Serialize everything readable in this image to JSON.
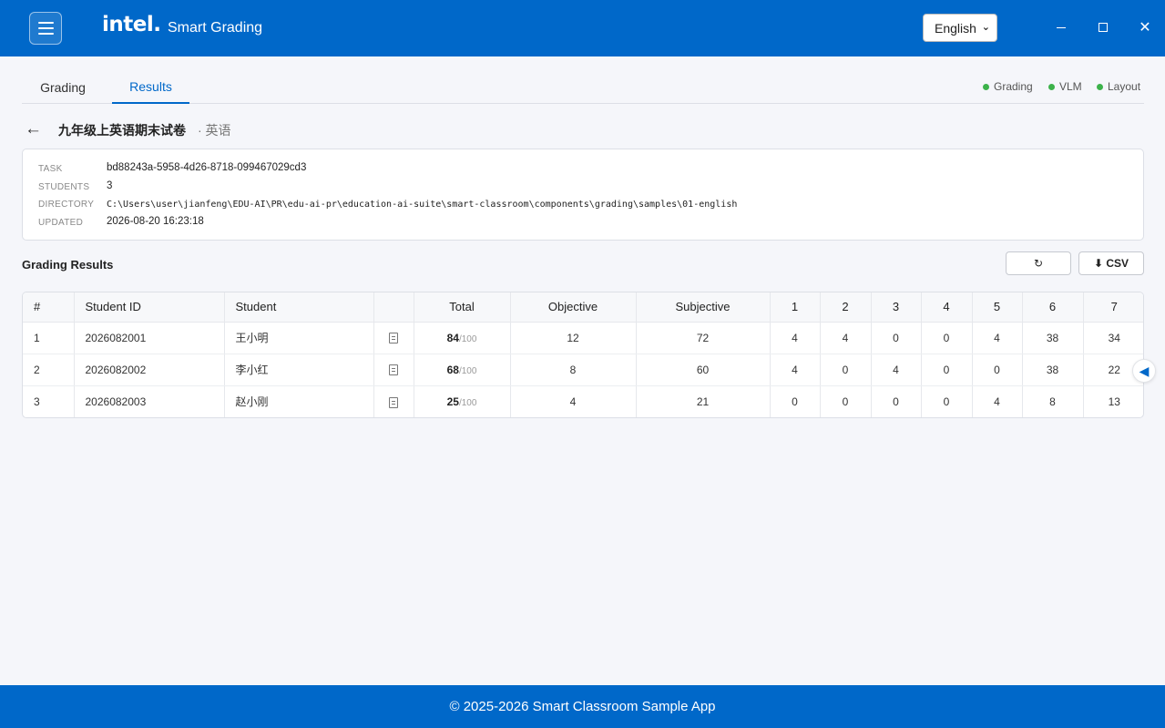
{
  "header": {
    "logo_text": "intel.",
    "app_title": "Smart Grading",
    "language": "English",
    "close_glyph": "✕"
  },
  "tabs": [
    {
      "label": "Grading",
      "active": false
    },
    {
      "label": "Results",
      "active": true
    }
  ],
  "status": [
    {
      "label": "Grading",
      "color": "#3cb24a"
    },
    {
      "label": "VLM",
      "color": "#3cb24a"
    },
    {
      "label": "Layout",
      "color": "#3cb24a"
    }
  ],
  "exam": {
    "back_glyph": "←",
    "title": "九年级上英语期末试卷",
    "subject": "· 英语"
  },
  "info": {
    "task_label": "TASK",
    "task_value": "bd88243a-5958-4d26-8718-099467029cd3",
    "students_label": "STUDENTS",
    "students_value": "3",
    "directory_label": "DIRECTORY",
    "directory_value": "C:\\Users\\user\\jianfeng\\EDU-AI\\PR\\edu-ai-pr\\education-ai-suite\\smart-classroom\\components\\grading\\samples\\01-english",
    "updated_label": "UPDATED",
    "updated_value": "2026-08-20 16:23:18"
  },
  "results": {
    "title": "Grading Results",
    "refresh_icon": "refresh-icon",
    "refresh_glyph": "↻",
    "csv_label": "⬇ CSV",
    "columns": {
      "num": "#",
      "student_id": "Student ID",
      "student": "Student",
      "total": "Total",
      "objective": "Objective",
      "subjective": "Subjective",
      "q1": "1",
      "q2": "2",
      "q3": "3",
      "q4": "4",
      "q5": "5",
      "q6": "6",
      "q7": "7"
    },
    "rows": [
      {
        "num": "1",
        "student_id": "2026082001",
        "student": "王小明",
        "total": "84",
        "max": "/100",
        "objective": "12",
        "subjective": "72",
        "q": [
          "4",
          "4",
          "0",
          "0",
          "4",
          "38",
          "34"
        ]
      },
      {
        "num": "2",
        "student_id": "2026082002",
        "student": "李小红",
        "total": "68",
        "max": "/100",
        "objective": "8",
        "subjective": "60",
        "q": [
          "4",
          "0",
          "4",
          "0",
          "0",
          "38",
          "22"
        ]
      },
      {
        "num": "3",
        "student_id": "2026082003",
        "student": "赵小刚",
        "total": "25",
        "max": "/100",
        "objective": "4",
        "subjective": "21",
        "q": [
          "0",
          "0",
          "0",
          "0",
          "4",
          "8",
          "13"
        ]
      }
    ]
  },
  "side_toggle_glyph": "◀",
  "footer": {
    "text": "© 2025-2026 Smart Classroom Sample App"
  },
  "colors": {
    "brand": "#0068c9",
    "ok": "#3cb24a"
  }
}
